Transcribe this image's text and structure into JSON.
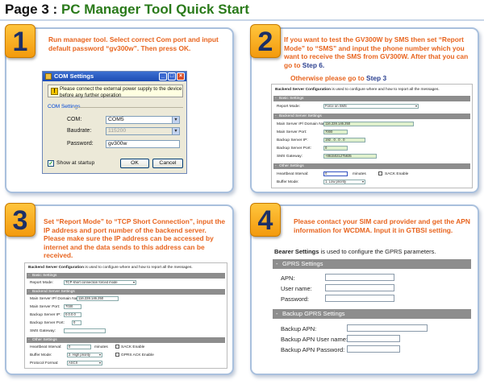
{
  "page": {
    "title_prefix": "Page 3 :",
    "title_main": "PC Manager Tool Quick Start"
  },
  "colors": {
    "accent_orange": "#e8641e",
    "title_green": "#2a7a1a",
    "step_badge": "#f5a623"
  },
  "steps": [
    {
      "number": "1",
      "text": "Run manager tool. Select correct Com port and input default password “gv300w”. Then press OK.",
      "dialog": {
        "title": "COM Settings",
        "notice": "Please connect the external power supply to the device before any further operation",
        "group_label": "COM Settings",
        "com_label": "COM:",
        "com_value": "COM5",
        "baud_label": "Baudrate:",
        "baud_value": "115200",
        "password_label": "Password:",
        "password_value": "gv300w",
        "show_startup_label": "Show at startup",
        "ok_label": "OK",
        "cancel_label": "Cancel"
      }
    },
    {
      "number": "2",
      "text_a": "If you want to test the GV300W by SMS then set “Report Mode” to “SMS” and input the phone number which you want to receive the SMS from GV300W. After that you can go to ",
      "text_a_link": "Step 6.",
      "text_b": "Otherwise please go to ",
      "text_b_link": "Step 3",
      "panel": {
        "header_bold": "Backend Server Configuration",
        "header_rest": " is used to configure where and how to report all the messages.",
        "sec_basic": "Basic Settings",
        "report_mode_label": "Report Mode:",
        "report_mode_value": "Force on SMS",
        "sec_backend": "Backend Server Settings",
        "main_ip_label": "Main Server IP/ Domain Name:",
        "main_ip_value": "116.228.146.250",
        "main_port_label": "Main Server Port:",
        "main_port_value": "7000",
        "backup_ip_label": "Backup Server IP:",
        "backup_ip_value": "192 . 0 . 0 . 0",
        "backup_port_label": "Backup Server Port:",
        "backup_port_value": "0",
        "sms_gateway_label": "SMS Gateway:",
        "sms_gateway_value": "+8615021275835",
        "sec_other": "Other Settings",
        "heartbeat_label": "Heartbeat Interval:",
        "heartbeat_value": "0",
        "minutes_label": "minutes",
        "sack_label": "SACK Enable",
        "buffer_label": "Buffer Mode:",
        "buffer_value": "1. Low priority"
      }
    },
    {
      "number": "3",
      "text": "Set “Report Mode” to “TCP Short Connection”, input the IP address and port number of the backend server. Please make sure the IP address can be accessed by internet and the data sends to this address can be received.",
      "panel": {
        "header_bold": "Backend Server Configuration",
        "header_rest": " is used to configure where and how to report all the messages.",
        "sec_basic": "Basic Settings",
        "report_mode_label": "Report Mode:",
        "report_mode_value": "TCP short connection forced mode",
        "sec_backend": "Backend Server Settings",
        "main_ip_label": "Main Server IP/ Domain Name:",
        "main_ip_value": "116.228.146.250",
        "main_port_label": "Main Server Port:",
        "main_port_value": "7030",
        "backup_ip_label": "Backup Server IP:",
        "backup_ip_value": "0.0.0.0",
        "backup_port_label": "Backup Server Port:",
        "backup_port_value": "0",
        "sms_gateway_label": "SMS Gateway:",
        "sms_gateway_value": "",
        "sec_other": "Other Settings",
        "heartbeat_label": "Heartbeat Interval:",
        "heartbeat_value": "0",
        "minutes_label": "minutes",
        "sack_label": "SACK Enable",
        "buffer_label": "Buffer Mode:",
        "buffer_value": "2. High priority",
        "gprs_ack_label": "GPRS ACK Enable",
        "protocol_label": "Protocol Format:",
        "protocol_value": "ASCII"
      }
    },
    {
      "number": "4",
      "text": "Please contact your SIM card provider and get the APN information for WCDMA. Input it in GTBSI setting.",
      "panel": {
        "header_bold": "Bearer Settings",
        "header_rest": " is used to configure the GPRS parameters.",
        "sec_gprs": "GPRS Settings",
        "apn_label": "APN:",
        "user_label": "User name:",
        "password_label": "Password:",
        "sec_backup": "Backup GPRS Settings",
        "backup_apn_label": "Backup APN:",
        "backup_user_label": "Backup APN User name:",
        "backup_password_label": "Backup APN Password:"
      }
    }
  ]
}
